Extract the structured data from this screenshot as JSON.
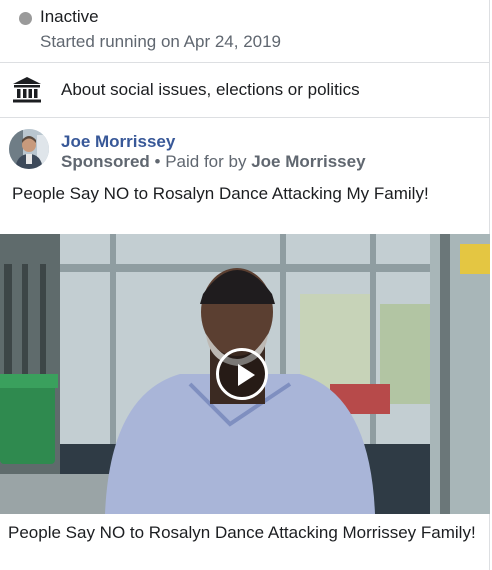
{
  "status": {
    "label": "Inactive",
    "date_text": "Started running on Apr 24, 2019",
    "dot_color": "#9a9a9a",
    "icon": "status-dot-icon"
  },
  "category": {
    "icon": "bank-icon",
    "text": "About social issues, elections or politics"
  },
  "ad": {
    "page_name": "Joe Morrissey",
    "sponsored_label": "Sponsored",
    "separator": " • ",
    "paid_for_prefix": "Paid for by ",
    "paid_for_name": "Joe Morrissey",
    "body_text": "People Say NO to Rosalyn Dance Attacking My Family!",
    "video_icon": "play-icon",
    "caption": "People Say NO to Rosalyn Dance Attacking Morrissey Family!"
  },
  "colors": {
    "link": "#385898",
    "secondary_text": "#606770",
    "border": "#dddfe2"
  }
}
